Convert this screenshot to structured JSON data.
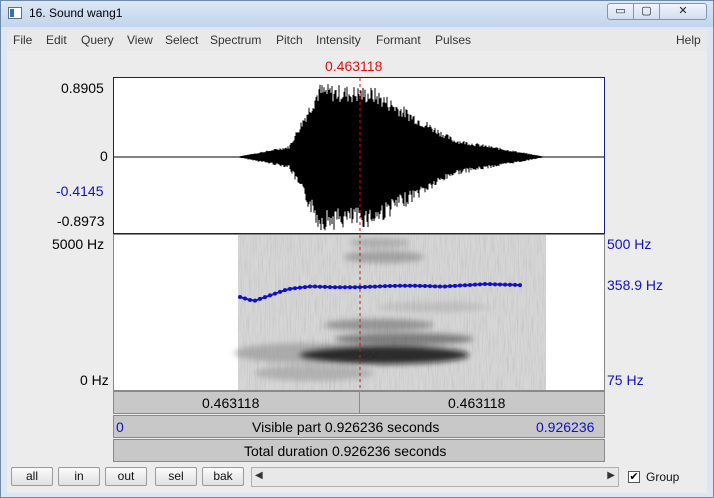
{
  "window": {
    "title": "16. Sound wang1",
    "controls": {
      "minimize": "▭",
      "maximize": "▢",
      "close": "✕"
    }
  },
  "menu": [
    "File",
    "Edit",
    "Query",
    "View",
    "Select",
    "Spectrum",
    "Pitch",
    "Intensity",
    "Formant",
    "Pulses",
    "Help"
  ],
  "cursor": {
    "time": "0.463118",
    "color": "#e01010"
  },
  "waveform": {
    "labels": {
      "max": "0.8905",
      "zero": "0",
      "cursor_value": "-0.4145",
      "min": "-0.8973"
    }
  },
  "spectrogram": {
    "freq_max": "5000 Hz",
    "freq_min": "0 Hz",
    "pitch_max": "500 Hz",
    "pitch_cursor": "358.9 Hz",
    "pitch_min": "75 Hz",
    "pitch_color": "#1010c8"
  },
  "bars": {
    "left_segment": "0.463118",
    "right_segment": "0.463118",
    "visible_start": "0",
    "visible_text": "Visible part 0.926236 seconds",
    "visible_end": "0.926236",
    "total_text": "Total duration 0.926236 seconds"
  },
  "buttons": [
    "all",
    "in",
    "out",
    "sel",
    "bak"
  ],
  "group": {
    "label": "Group",
    "checked": "✔"
  }
}
